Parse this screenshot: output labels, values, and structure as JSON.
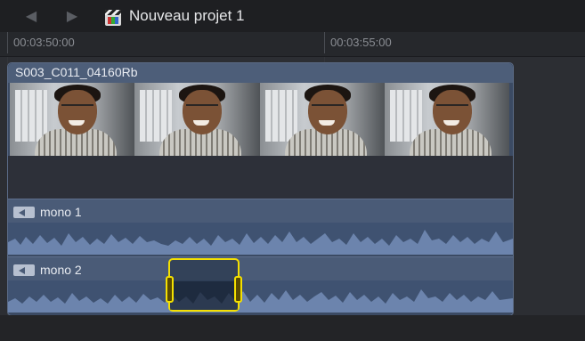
{
  "titlebar": {
    "back_icon": "chevron-left-icon",
    "forward_icon": "chevron-right-icon",
    "project_icon": "project-film-icon",
    "title": "Nouveau projet 1"
  },
  "ruler": {
    "ticks": [
      "00:03:50:00",
      "00:03:55:00"
    ]
  },
  "clip": {
    "name": "S003_C011_04160Rb",
    "frames": 4,
    "audio_tracks": [
      {
        "label": "mono 1",
        "icon": "speaker-icon"
      },
      {
        "label": "mono 2",
        "icon": "speaker-icon"
      }
    ]
  },
  "colors": {
    "selection": "#f4e000",
    "clip_blue": "#4a5b77"
  }
}
